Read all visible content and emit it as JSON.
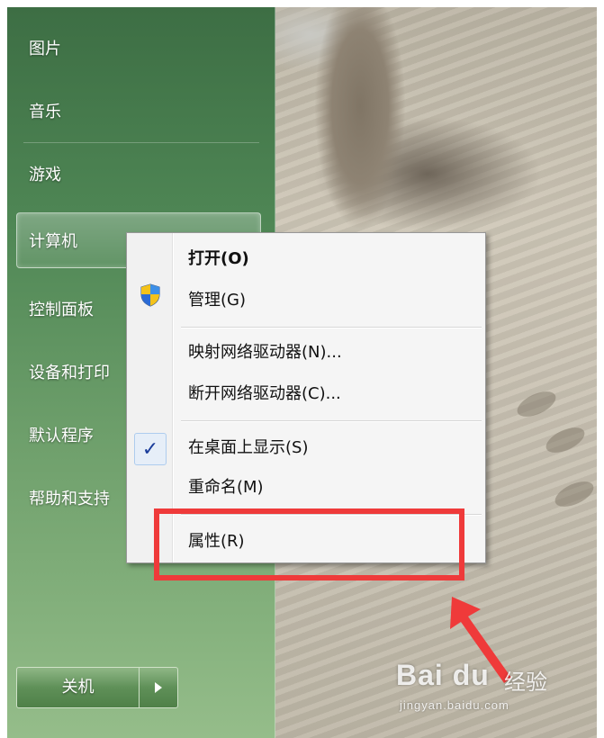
{
  "start_menu": {
    "items": [
      {
        "label": "图片"
      },
      {
        "label": "音乐"
      },
      {
        "label": "游戏"
      },
      {
        "label": "计算机"
      },
      {
        "label": "控制面板"
      },
      {
        "label": "设备和打印"
      },
      {
        "label": "默认程序"
      },
      {
        "label": "帮助和支持"
      }
    ],
    "shutdown_label": "关机"
  },
  "context_menu": {
    "items": [
      {
        "label": "打开(O)",
        "bold": true,
        "icon": ""
      },
      {
        "label": "管理(G)",
        "icon": "uac-shield-icon"
      },
      {
        "label": "映射网络驱动器(N)..."
      },
      {
        "label": "断开网络驱动器(C)..."
      },
      {
        "label": "在桌面上显示(S)",
        "checked": true
      },
      {
        "label": "重命名(M)"
      },
      {
        "label": "属性(R)",
        "highlighted": true
      }
    ]
  },
  "annotation": {
    "box_color": "#ef3a3a",
    "arrow_color": "#ef3a3a",
    "target": "属性(R)"
  },
  "watermark": {
    "logo": "Bai du",
    "text": "经验",
    "url": "jingyan.baidu.com"
  },
  "colors": {
    "start_menu_green": "#4f8755",
    "menu_background": "#f5f5f5",
    "checkmark": "#1a3c9a"
  }
}
